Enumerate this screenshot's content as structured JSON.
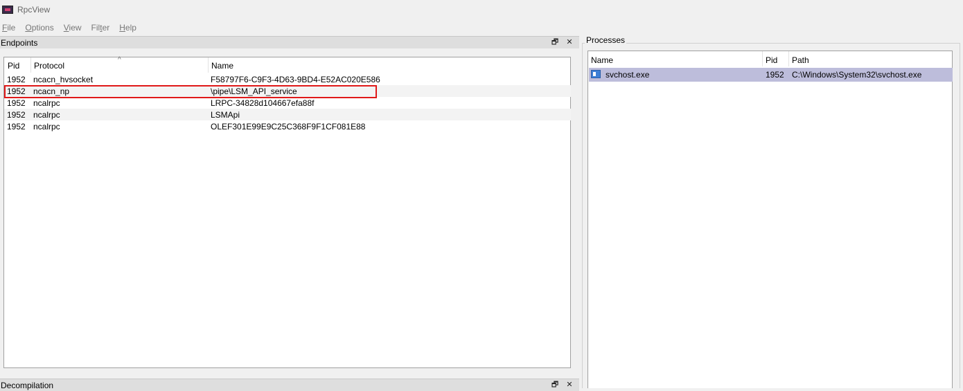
{
  "window": {
    "title": "RpcView"
  },
  "menu": [
    {
      "accel": "F",
      "rest": "ile"
    },
    {
      "accel": "O",
      "rest": "ptions"
    },
    {
      "accel": "V",
      "rest": "iew"
    },
    {
      "pre": "Fil",
      "accel": "t",
      "rest": "er"
    },
    {
      "accel": "H",
      "rest": "elp"
    }
  ],
  "endpoints": {
    "title": "Endpoints",
    "restore_icon": "🗗",
    "close_icon": "✕",
    "sort_indicator": "^",
    "columns": {
      "pid": "Pid",
      "protocol": "Protocol",
      "name": "Name"
    },
    "rows": [
      {
        "pid": "1952",
        "protocol": "ncacn_hvsocket",
        "name": "F58797F6-C9F3-4D63-9BD4-E52AC020E586"
      },
      {
        "pid": "1952",
        "protocol": "ncacn_np",
        "name": "\\pipe\\LSM_API_service"
      },
      {
        "pid": "1952",
        "protocol": "ncalrpc",
        "name": "LRPC-34828d104667efa88f"
      },
      {
        "pid": "1952",
        "protocol": "ncalrpc",
        "name": "LSMApi"
      },
      {
        "pid": "1952",
        "protocol": "ncalrpc",
        "name": "OLEF301E99E9C25C368F9F1CF081E88"
      }
    ],
    "highlight_color": "#e01818"
  },
  "decompilation": {
    "title": "Decompilation",
    "restore_icon": "🗗",
    "close_icon": "✕"
  },
  "processes": {
    "title": "Processes",
    "columns": {
      "name": "Name",
      "pid": "Pid",
      "path": "Path"
    },
    "rows": [
      {
        "name": "svchost.exe",
        "pid": "1952",
        "path": "C:\\Windows\\System32\\svchost.exe"
      }
    ],
    "selection_color": "#bdbddb"
  }
}
